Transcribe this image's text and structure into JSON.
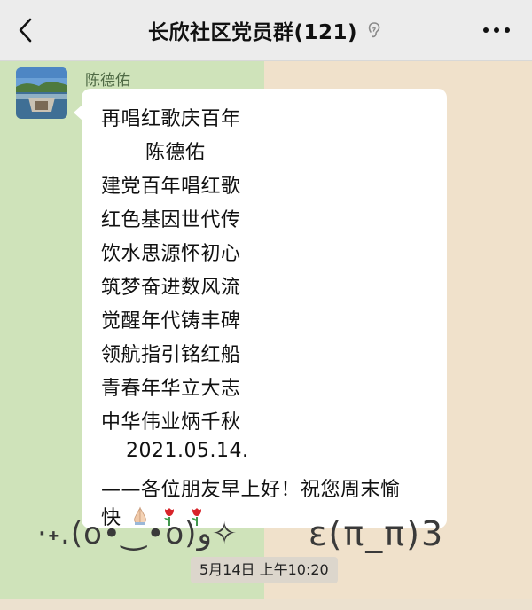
{
  "header": {
    "title": "长欣社区党员群(121)",
    "back_icon": "chevron-left-icon",
    "mute_icon": "ear-mute-icon",
    "more_icon": "more-dots-icon"
  },
  "message": {
    "sender": "陈德佑",
    "lines": [
      "再唱红歌庆百年",
      "陈德佑",
      "建党百年唱红歌",
      "红色基因世代传",
      "饮水思源怀初心",
      "筑梦奋进数风流",
      "觉醒年代铸丰碑",
      "领航指引铭红船",
      "青春年华立大志",
      "中华伟业炳千秋",
      "2021.05.14.",
      "——各位朋友早上好！祝您周末愉",
      "快"
    ],
    "emoji": [
      "🙏",
      "🌹",
      "🌹"
    ]
  },
  "decor": {
    "kaomoji_left": "·˖.(o•‿•o)و✧",
    "kaomoji_right": "ε(π_π)3"
  },
  "timestamp": "5月14日 上午10:20",
  "colors": {
    "wallpaper_left": "#cfe3ba",
    "wallpaper_right": "#f0e1cb",
    "bubble": "#ffffff",
    "header_bg": "#ececec"
  }
}
